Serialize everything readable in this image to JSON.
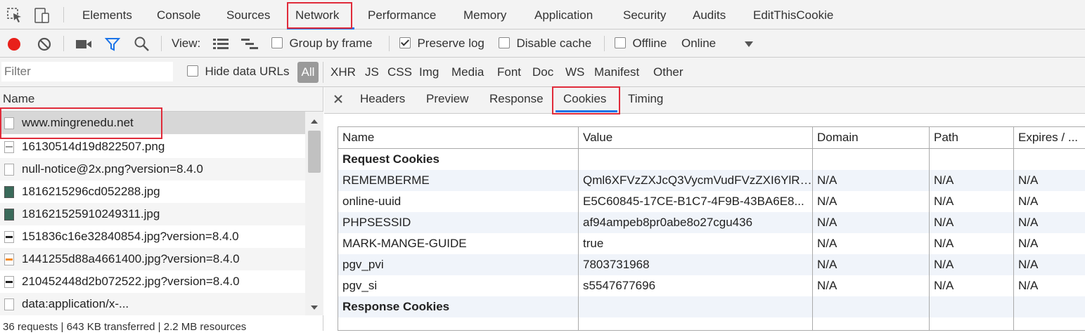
{
  "main_tabs": [
    "Elements",
    "Console",
    "Sources",
    "Network",
    "Performance",
    "Memory",
    "Application",
    "Security",
    "Audits",
    "EditThisCookie"
  ],
  "toolbar": {
    "view_label": "View:",
    "group_by_frame": "Group by frame",
    "preserve_log": "Preserve log",
    "disable_cache": "Disable cache",
    "offline": "Offline",
    "throttle": "Online"
  },
  "filter": {
    "placeholder": "Filter",
    "hide_data_urls": "Hide data URLs",
    "all": "All",
    "types": [
      "XHR",
      "JS",
      "CSS",
      "Img",
      "Media",
      "Font",
      "Doc",
      "WS",
      "Manifest",
      "Other"
    ]
  },
  "requests": {
    "header": "Name",
    "items": [
      "www.mingrenedu.net",
      "16130514d19d822507.png",
      "null-notice@2x.png?version=8.4.0",
      "1816215296cd052288.jpg",
      "181621525910249311.jpg",
      "151836c16e32840854.jpg?version=8.4.0",
      "1441255d88a4661400.jpg?version=8.4.0",
      "210452448d2b072522.jpg?version=8.4.0",
      "data:application/x-..."
    ],
    "status": "36 requests | 643 KB transferred | 2.2 MB resources"
  },
  "detail_tabs": [
    "Headers",
    "Preview",
    "Response",
    "Cookies",
    "Timing"
  ],
  "cookies": {
    "columns": [
      "Name",
      "Value",
      "Domain",
      "Path",
      "Expires / ..."
    ],
    "request_section": "Request Cookies",
    "rows": [
      {
        "name": "REMEMBERME",
        "value": "Qml6XFVzZXJcQ3VycmVudFVzZXI6YlRR...",
        "domain": "N/A",
        "path": "N/A",
        "expires": "N/A"
      },
      {
        "name": "online-uuid",
        "value": "E5C60845-17CE-B1C7-4F9B-43BA6E8...",
        "domain": "N/A",
        "path": "N/A",
        "expires": "N/A"
      },
      {
        "name": "PHPSESSID",
        "value": "af94ampeb8pr0abe8o27cgu436",
        "domain": "N/A",
        "path": "N/A",
        "expires": "N/A"
      },
      {
        "name": "MARK-MANGE-GUIDE",
        "value": "true",
        "domain": "N/A",
        "path": "N/A",
        "expires": "N/A"
      },
      {
        "name": "pgv_pvi",
        "value": "7803731968",
        "domain": "N/A",
        "path": "N/A",
        "expires": "N/A"
      },
      {
        "name": "pgv_si",
        "value": "s5547677696",
        "domain": "N/A",
        "path": "N/A",
        "expires": "N/A"
      }
    ],
    "response_section": "Response Cookies"
  },
  "colors": {
    "accent": "#1a73e8",
    "record": "#e8201a",
    "highlight": "#e02b3a"
  }
}
